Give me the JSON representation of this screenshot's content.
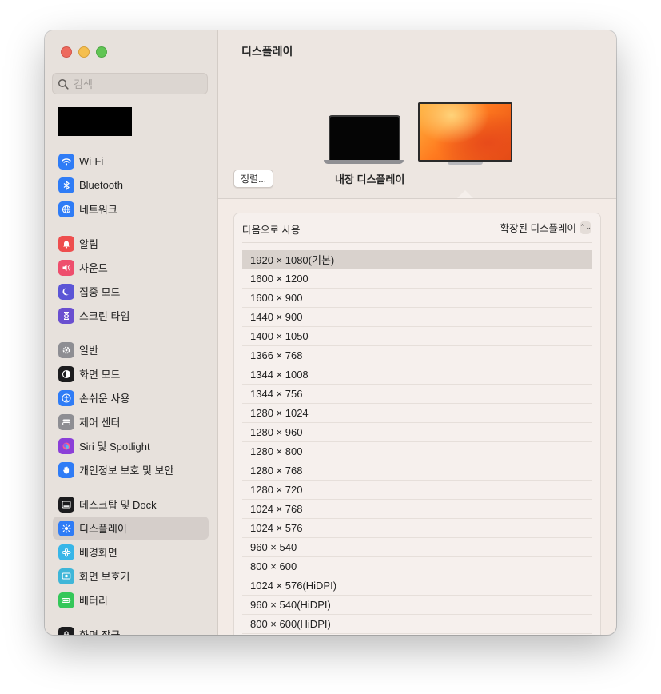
{
  "sidebar": {
    "search_placeholder": "검색",
    "groups": [
      [
        {
          "label": "Wi-Fi",
          "icon": "wifi-icon",
          "color": "#2f7cf6"
        },
        {
          "label": "Bluetooth",
          "icon": "bluetooth-icon",
          "color": "#2f7cf6"
        },
        {
          "label": "네트워크",
          "icon": "globe-icon",
          "color": "#2f7cf6"
        }
      ],
      [
        {
          "label": "알림",
          "icon": "bell-icon",
          "color": "#ee4e4e"
        },
        {
          "label": "사운드",
          "icon": "speaker-icon",
          "color": "#ee4e6d"
        },
        {
          "label": "집중 모드",
          "icon": "moon-icon",
          "color": "#5b55d6"
        },
        {
          "label": "스크린 타임",
          "icon": "hourglass-icon",
          "color": "#6a4fd0"
        }
      ],
      [
        {
          "label": "일반",
          "icon": "gear-icon",
          "color": "#8e8e93"
        },
        {
          "label": "화면 모드",
          "icon": "appearance-icon",
          "color": "#1c1c1e"
        },
        {
          "label": "손쉬운 사용",
          "icon": "accessibility-icon",
          "color": "#2f7cf6"
        },
        {
          "label": "제어 센터",
          "icon": "control-center-icon",
          "color": "#8e8e93"
        },
        {
          "label": "Siri 및 Spotlight",
          "icon": "siri-icon",
          "color": "#8b3fd8"
        },
        {
          "label": "개인정보 보호 및 보안",
          "icon": "hand-icon",
          "color": "#2f7cf6"
        }
      ],
      [
        {
          "label": "데스크탑 및 Dock",
          "icon": "dock-icon",
          "color": "#1c1c1e"
        },
        {
          "label": "디스플레이",
          "icon": "sun-icon",
          "color": "#2f7cf6",
          "active": true
        },
        {
          "label": "배경화면",
          "icon": "flower-icon",
          "color": "#38b6e8"
        },
        {
          "label": "화면 보호기",
          "icon": "screensaver-icon",
          "color": "#3fb6d8"
        },
        {
          "label": "배터리",
          "icon": "battery-icon",
          "color": "#34c759"
        }
      ],
      [
        {
          "label": "화면 잠금",
          "icon": "lock-icon",
          "color": "#1c1c1e"
        }
      ]
    ]
  },
  "content": {
    "title": "디스플레이",
    "arrange_button": "정렬...",
    "display_label": "내장 디스플레이",
    "use_as_label": "다음으로 사용",
    "use_as_value": "확장된 디스플레이",
    "resolutions": [
      "1920 × 1080(기본)",
      "1600 × 1200",
      "1600 × 900",
      "1440 × 900",
      "1400 × 1050",
      "1366 × 768",
      "1344 × 1008",
      "1344 × 756",
      "1280 × 1024",
      "1280 × 960",
      "1280 × 800",
      "1280 × 768",
      "1280 × 720",
      "1024 × 768",
      "1024 × 576",
      "960 × 540",
      "800 × 600",
      "1024 × 576(HiDPI)",
      "960 × 540(HiDPI)",
      "800 × 600(HiDPI)"
    ],
    "selected_resolution_index": 0
  }
}
